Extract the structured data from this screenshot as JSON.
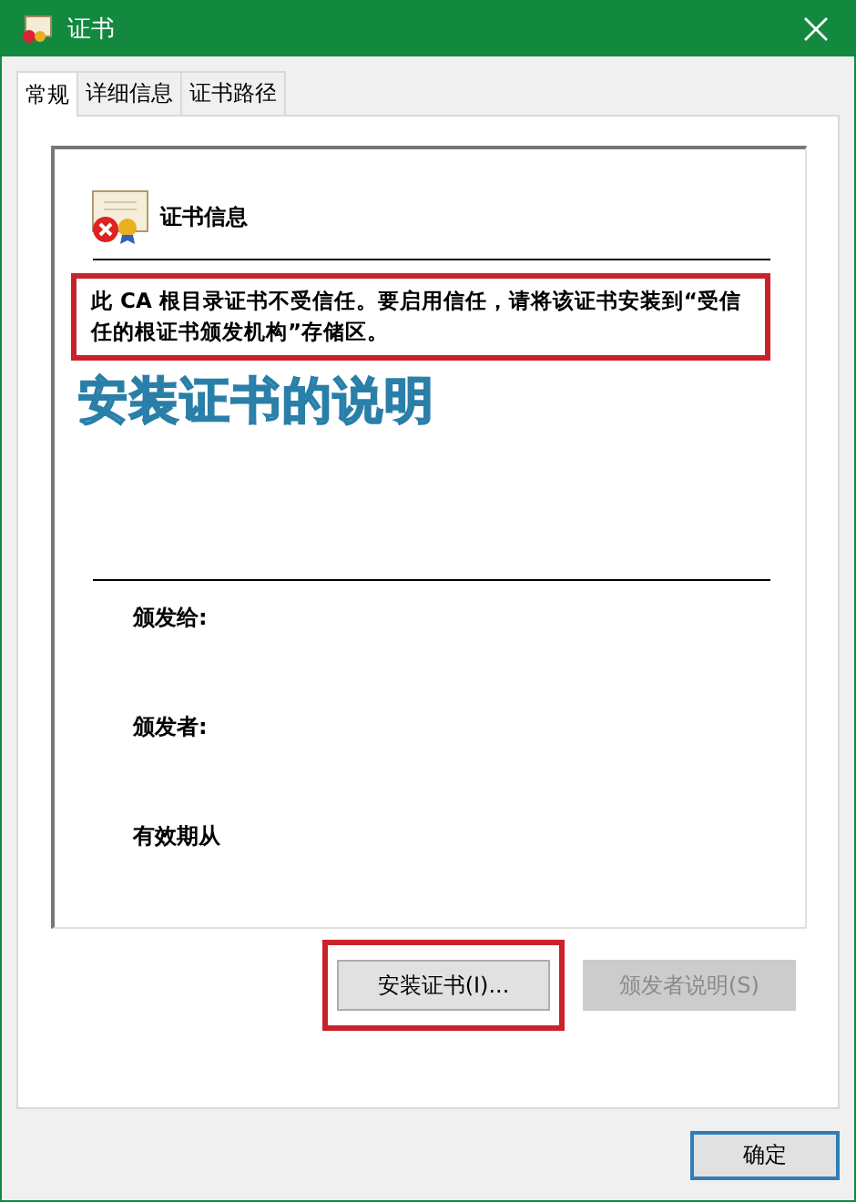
{
  "window": {
    "title": "证书"
  },
  "tabs": [
    {
      "label": "常规",
      "selected": true
    },
    {
      "label": "详细信息",
      "selected": false
    },
    {
      "label": "证书路径",
      "selected": false
    }
  ],
  "certificate": {
    "heading": "证书信息",
    "message": "此 CA 根目录证书不受信任。要启用信任，请将该证书安装到“受信任的根证书颁发机构”存储区。",
    "message_highlighted": true,
    "fields": [
      {
        "label": "颁发给:"
      },
      {
        "label": "颁发者:"
      },
      {
        "label": "有效期从"
      }
    ]
  },
  "annotation": {
    "caption": "安装证书的说明"
  },
  "buttons": [
    {
      "label": "安装证书(I)...",
      "disabled": false,
      "highlighted": true
    },
    {
      "label": "颁发者说明(S)",
      "disabled": true,
      "highlighted": false
    }
  ],
  "footer_buttons": [
    {
      "label": "确定",
      "default": true
    }
  ]
}
